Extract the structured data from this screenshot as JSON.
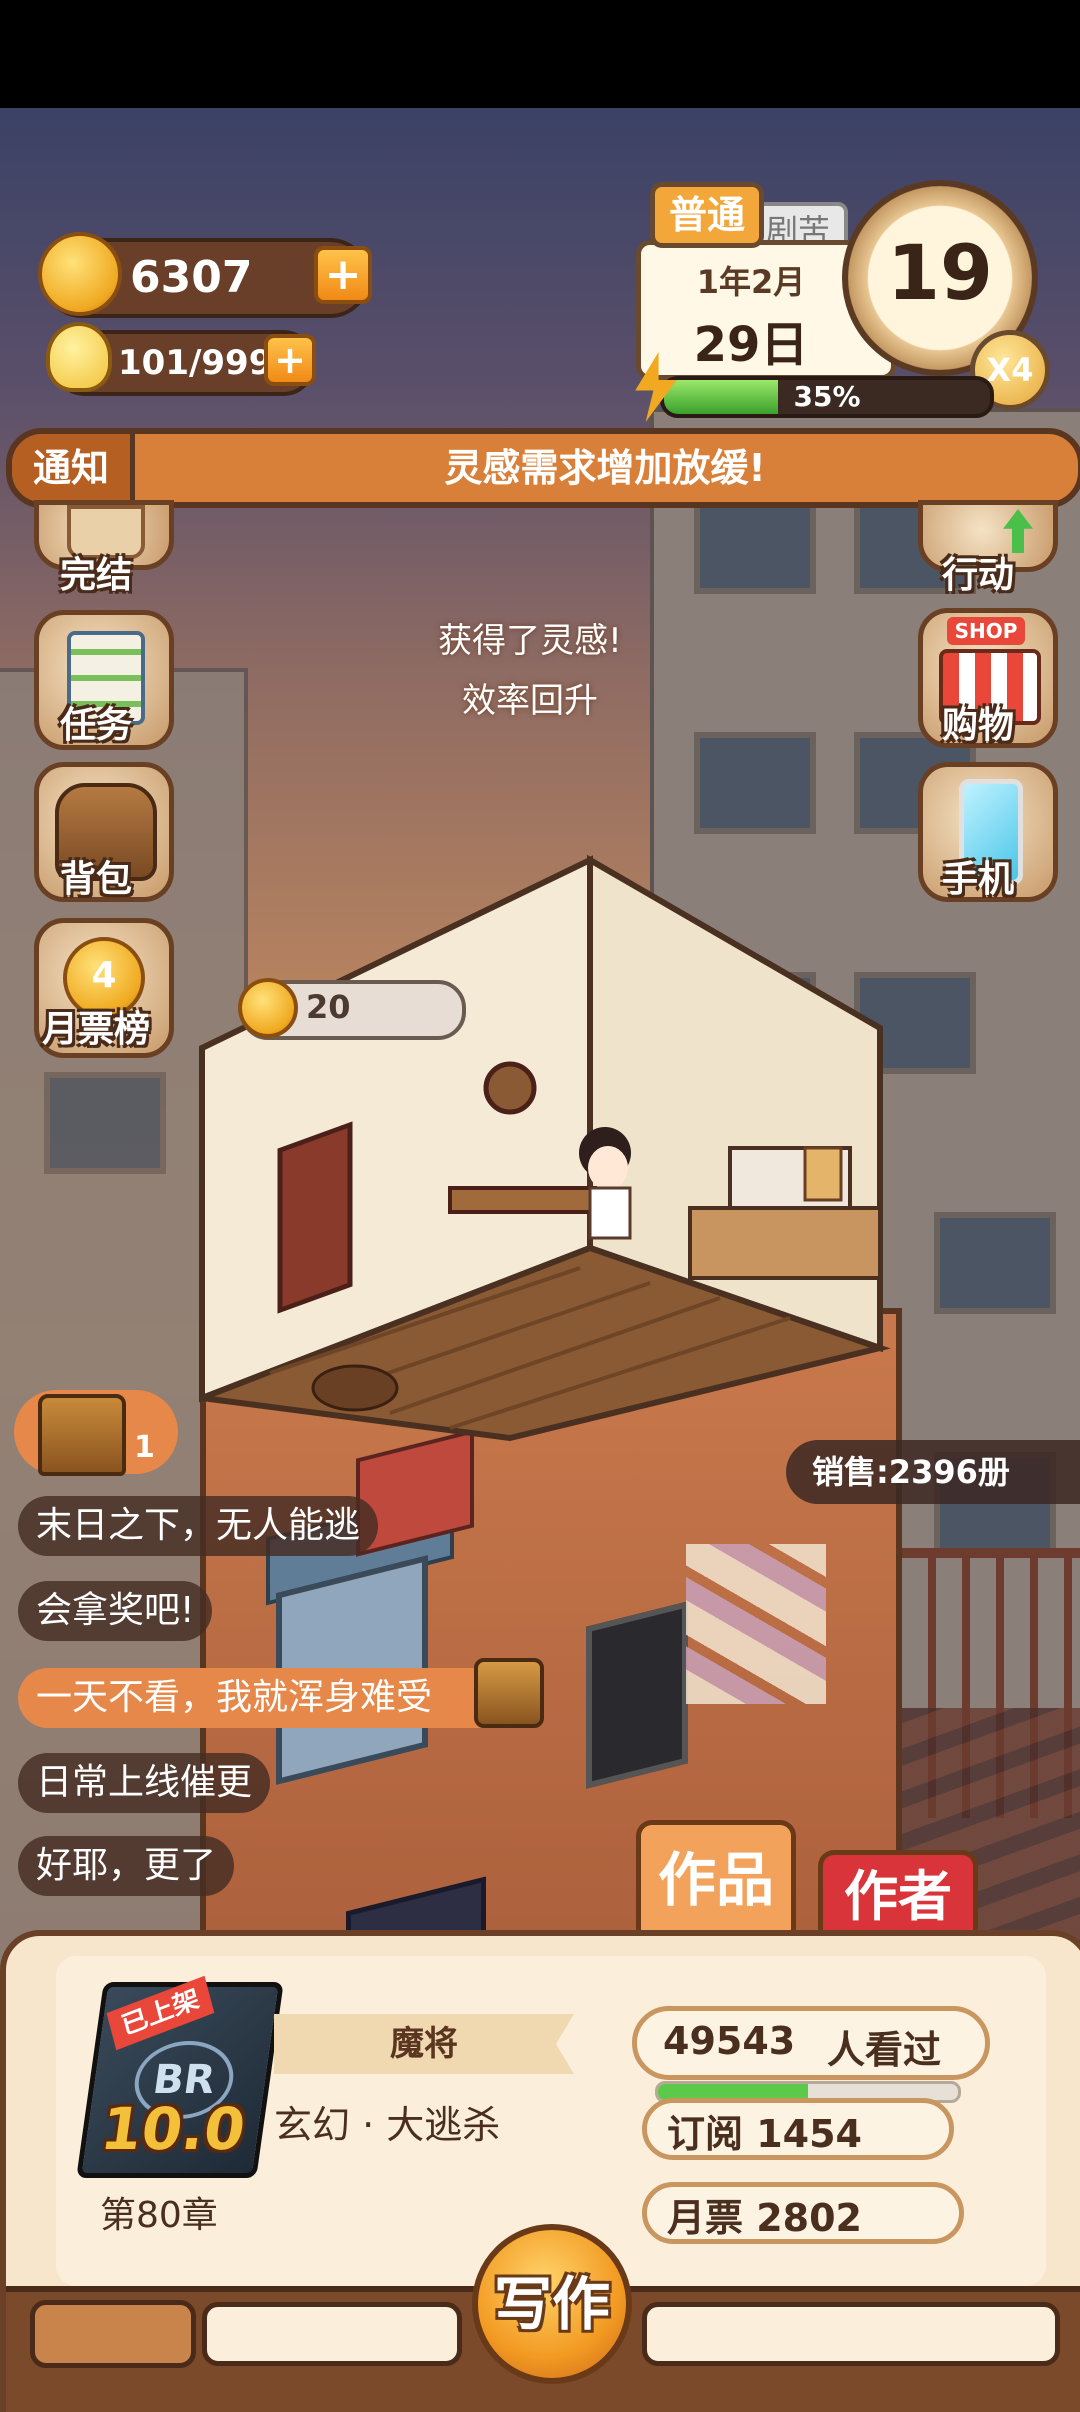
{
  "hud": {
    "coins": "6307",
    "inspiration": "101/999",
    "add_glyph": "+",
    "colors": {
      "coin": "#f0a920",
      "accent": "#e6884a",
      "bar": "#5cc94a"
    }
  },
  "calendar": {
    "mode_tag": "普通",
    "back_tag": "剧苦",
    "year_month": "1年2月",
    "day": "29日",
    "time_value": "19",
    "speed": "X4",
    "energy_percent_label": "35%",
    "energy_fraction": 0.35
  },
  "notice": {
    "tag": "通知",
    "message": "灵感需求增加放缓!"
  },
  "side_left": [
    {
      "id": "finish",
      "label": "完结",
      "icon": "scroll-icon"
    },
    {
      "id": "tasks",
      "label": "任务",
      "icon": "checklist-icon"
    },
    {
      "id": "bag",
      "label": "背包",
      "icon": "backpack-icon"
    },
    {
      "id": "ticket-rank",
      "label": "月票榜",
      "icon": "medal-icon",
      "badge": "4"
    }
  ],
  "side_right": [
    {
      "id": "action",
      "label": "行动",
      "icon": "action-icon"
    },
    {
      "id": "shop",
      "label": "购物",
      "icon": "shop-icon",
      "sign": "SHOP"
    },
    {
      "id": "phone",
      "label": "手机",
      "icon": "phone-icon"
    }
  ],
  "float_messages": {
    "line1": "获得了灵感!",
    "line2": "效率回升"
  },
  "room": {
    "coin_bubble": "20"
  },
  "treasure": {
    "count": "1"
  },
  "sales": "销售:2396册",
  "comments": [
    "末日之下，无人能逃",
    "会拿奖吧!",
    "一天不看，我就浑身难受",
    "日常上线催更",
    "好耶，更了"
  ],
  "tabs": {
    "works": "作品",
    "author": "作者"
  },
  "book": {
    "status_tag": "已上架",
    "cover_letters": "BR",
    "score": "10.0",
    "title": "魔将",
    "genre": "玄幻 · 大逃杀",
    "chapter": "第80章",
    "viewers": "49543",
    "viewers_label": "人看过",
    "viewers_fraction": 0.5,
    "subscriptions": "订阅 1454",
    "monthly_tickets": "月票 2802"
  },
  "write_button": "写作"
}
